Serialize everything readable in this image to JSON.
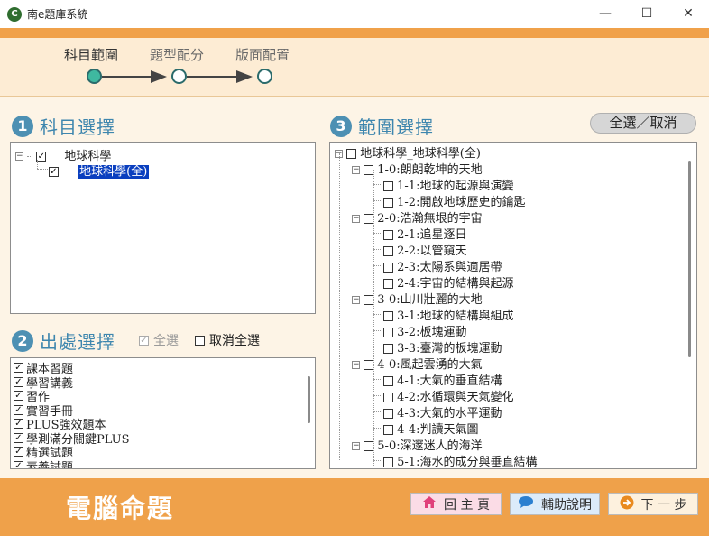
{
  "window": {
    "title": "南e題庫系統",
    "icon_glyph": "C",
    "minimize": "—",
    "maximize": "☐",
    "close": "✕"
  },
  "steps": [
    {
      "label": "科目範圍",
      "active": true
    },
    {
      "label": "題型配分",
      "active": false
    },
    {
      "label": "版面配置",
      "active": false
    }
  ],
  "section1": {
    "num": "1",
    "title": "科目選擇"
  },
  "section2": {
    "num": "2",
    "title": "出處選擇",
    "select_all": "全選",
    "deselect_all": "取消全選"
  },
  "section3": {
    "num": "3",
    "title": "範圍選擇",
    "select_toggle": "全選／取消"
  },
  "subject_tree": {
    "root": "地球科學",
    "child": "地球科學(全)"
  },
  "sources": [
    {
      "label": "課本習題",
      "checked": true
    },
    {
      "label": "學習講義",
      "checked": true
    },
    {
      "label": "習作",
      "checked": true
    },
    {
      "label": "實習手冊",
      "checked": true
    },
    {
      "label": "PLUS強效題本",
      "checked": true
    },
    {
      "label": "學測滿分關鍵PLUS",
      "checked": true
    },
    {
      "label": "精選試題",
      "checked": true
    },
    {
      "label": "素養試題",
      "checked": true
    }
  ],
  "range_tree": {
    "root": "地球科學_地球科學(全)",
    "nodes": [
      {
        "label": "1-0:朗朗乾坤的天地",
        "level": 1
      },
      {
        "label": "1-1:地球的起源與演變",
        "level": 2
      },
      {
        "label": "1-2:開啟地球歷史的鑰匙",
        "level": 2
      },
      {
        "label": "2-0:浩瀚無垠的宇宙",
        "level": 1
      },
      {
        "label": "2-1:追星逐日",
        "level": 2
      },
      {
        "label": "2-2:以管窺天",
        "level": 2
      },
      {
        "label": "2-3:太陽系與適居帶",
        "level": 2
      },
      {
        "label": "2-4:宇宙的結構與起源",
        "level": 2
      },
      {
        "label": "3-0:山川壯麗的大地",
        "level": 1
      },
      {
        "label": "3-1:地球的結構與組成",
        "level": 2
      },
      {
        "label": "3-2:板塊運動",
        "level": 2
      },
      {
        "label": "3-3:臺灣的板塊運動",
        "level": 2
      },
      {
        "label": "4-0:風起雲湧的大氣",
        "level": 1
      },
      {
        "label": "4-1:大氣的垂直結構",
        "level": 2
      },
      {
        "label": "4-2:水循環與天氣變化",
        "level": 2
      },
      {
        "label": "4-3:大氣的水平運動",
        "level": 2
      },
      {
        "label": "4-4:判讀天氣圖",
        "level": 2
      },
      {
        "label": "5-0:深邃迷人的海洋",
        "level": 1
      },
      {
        "label": "5-1:海水的成分與垂直結構",
        "level": 2
      }
    ]
  },
  "footer": {
    "brand": "電腦命題",
    "home": "回 主 頁",
    "help": "輔助說明",
    "next": "下 一 步"
  },
  "colors": {
    "accent_orange": "#efa14a",
    "section_blue": "#3e86ae",
    "selection_blue": "#0a3fbf"
  }
}
